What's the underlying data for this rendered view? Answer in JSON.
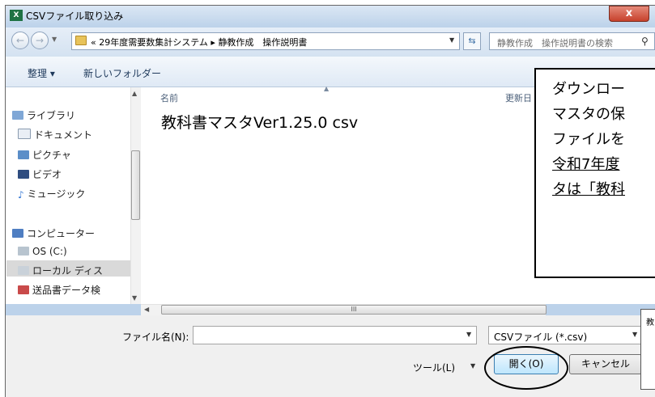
{
  "window": {
    "title": "CSVファイル取り込み",
    "app_icon": "excel-icon",
    "close_glyph": "x"
  },
  "nav": {
    "breadcrumb_prefix": "«",
    "breadcrumb_1": "29年度需要数集計システム",
    "breadcrumb_sep": "▸",
    "breadcrumb_2": "静教作成　操作説明書",
    "search_placeholder": "静教作成　操作説明書の検索"
  },
  "toolbar": {
    "organize_label": "整理 ▾",
    "new_folder_label": "新しいフォルダー"
  },
  "sidebar": {
    "items": [
      {
        "label": "ライブラリ",
        "icon": "library-icon"
      },
      {
        "label": "ドキュメント",
        "icon": "document-icon"
      },
      {
        "label": "ピクチャ",
        "icon": "picture-icon"
      },
      {
        "label": "ビデオ",
        "icon": "video-icon"
      },
      {
        "label": "ミュージック",
        "icon": "music-icon"
      },
      {
        "label": "コンピューター",
        "icon": "computer-icon"
      },
      {
        "label": "OS (C:)",
        "icon": "drive-icon"
      },
      {
        "label": "ローカル ディス",
        "icon": "drive-icon"
      },
      {
        "label": "送品書データ検",
        "icon": "network-drive-icon"
      }
    ]
  },
  "file_list": {
    "col_name": "名前",
    "col_modified": "更新日",
    "files": [
      {
        "name": "教科書マスタVer1.25.0 csv"
      }
    ],
    "hscroll_grip": "III"
  },
  "bottom": {
    "filename_label": "ファイル名(N):",
    "filename_value": "",
    "filetype_value": "CSVファイル (*.csv)",
    "tools_label": "ツール(L)",
    "open_label": "開く(O)",
    "cancel_label": "キャンセル"
  },
  "callout": {
    "lines": [
      {
        "text": "ダウンロー",
        "underline": false
      },
      {
        "text": "マスタの保",
        "underline": false
      },
      {
        "text": "ファイルを",
        "underline": false
      },
      {
        "text": "令和7年度",
        "underline": true
      },
      {
        "text": "タは「教科",
        "underline": true
      }
    ]
  },
  "mini_box_text": "教"
}
